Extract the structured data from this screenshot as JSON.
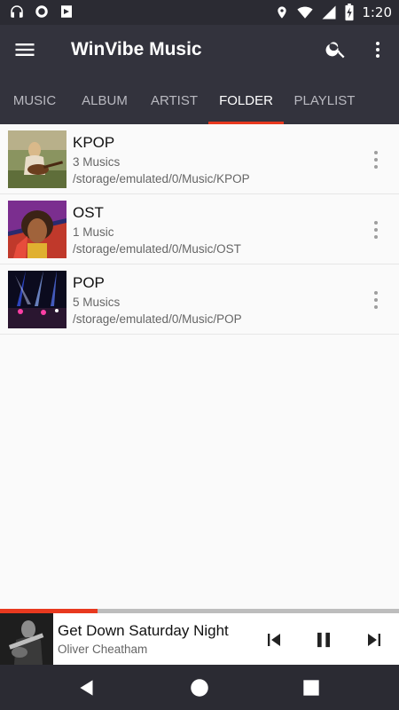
{
  "status_bar": {
    "time": "1:20",
    "left_icons": [
      "headphones-icon",
      "record-icon",
      "play-store-icon"
    ],
    "right_icons": [
      "location-icon",
      "wifi-icon",
      "signal-icon",
      "battery-charging-icon"
    ]
  },
  "app_bar": {
    "title": "WinVibe Music"
  },
  "tabs": [
    {
      "label": "MUSIC",
      "active": false
    },
    {
      "label": "ALBUM",
      "active": false
    },
    {
      "label": "ARTIST",
      "active": false
    },
    {
      "label": "FOLDER",
      "active": true
    },
    {
      "label": "PLAYLIST",
      "active": false
    }
  ],
  "folders": [
    {
      "name": "KPOP",
      "count": "3 Musics",
      "path": "/storage/emulated/0/Music/KPOP"
    },
    {
      "name": "OST",
      "count": "1 Music",
      "path": "/storage/emulated/0/Music/OST"
    },
    {
      "name": "POP",
      "count": "5 Musics",
      "path": "/storage/emulated/0/Music/POP"
    }
  ],
  "player": {
    "progress": 0.245,
    "title": "Get Down Saturday Night",
    "artist": "Oliver Cheatham"
  },
  "colors": {
    "accent": "#e8391f",
    "app_bar": "#33333d",
    "status_bar": "#2b2b33"
  }
}
